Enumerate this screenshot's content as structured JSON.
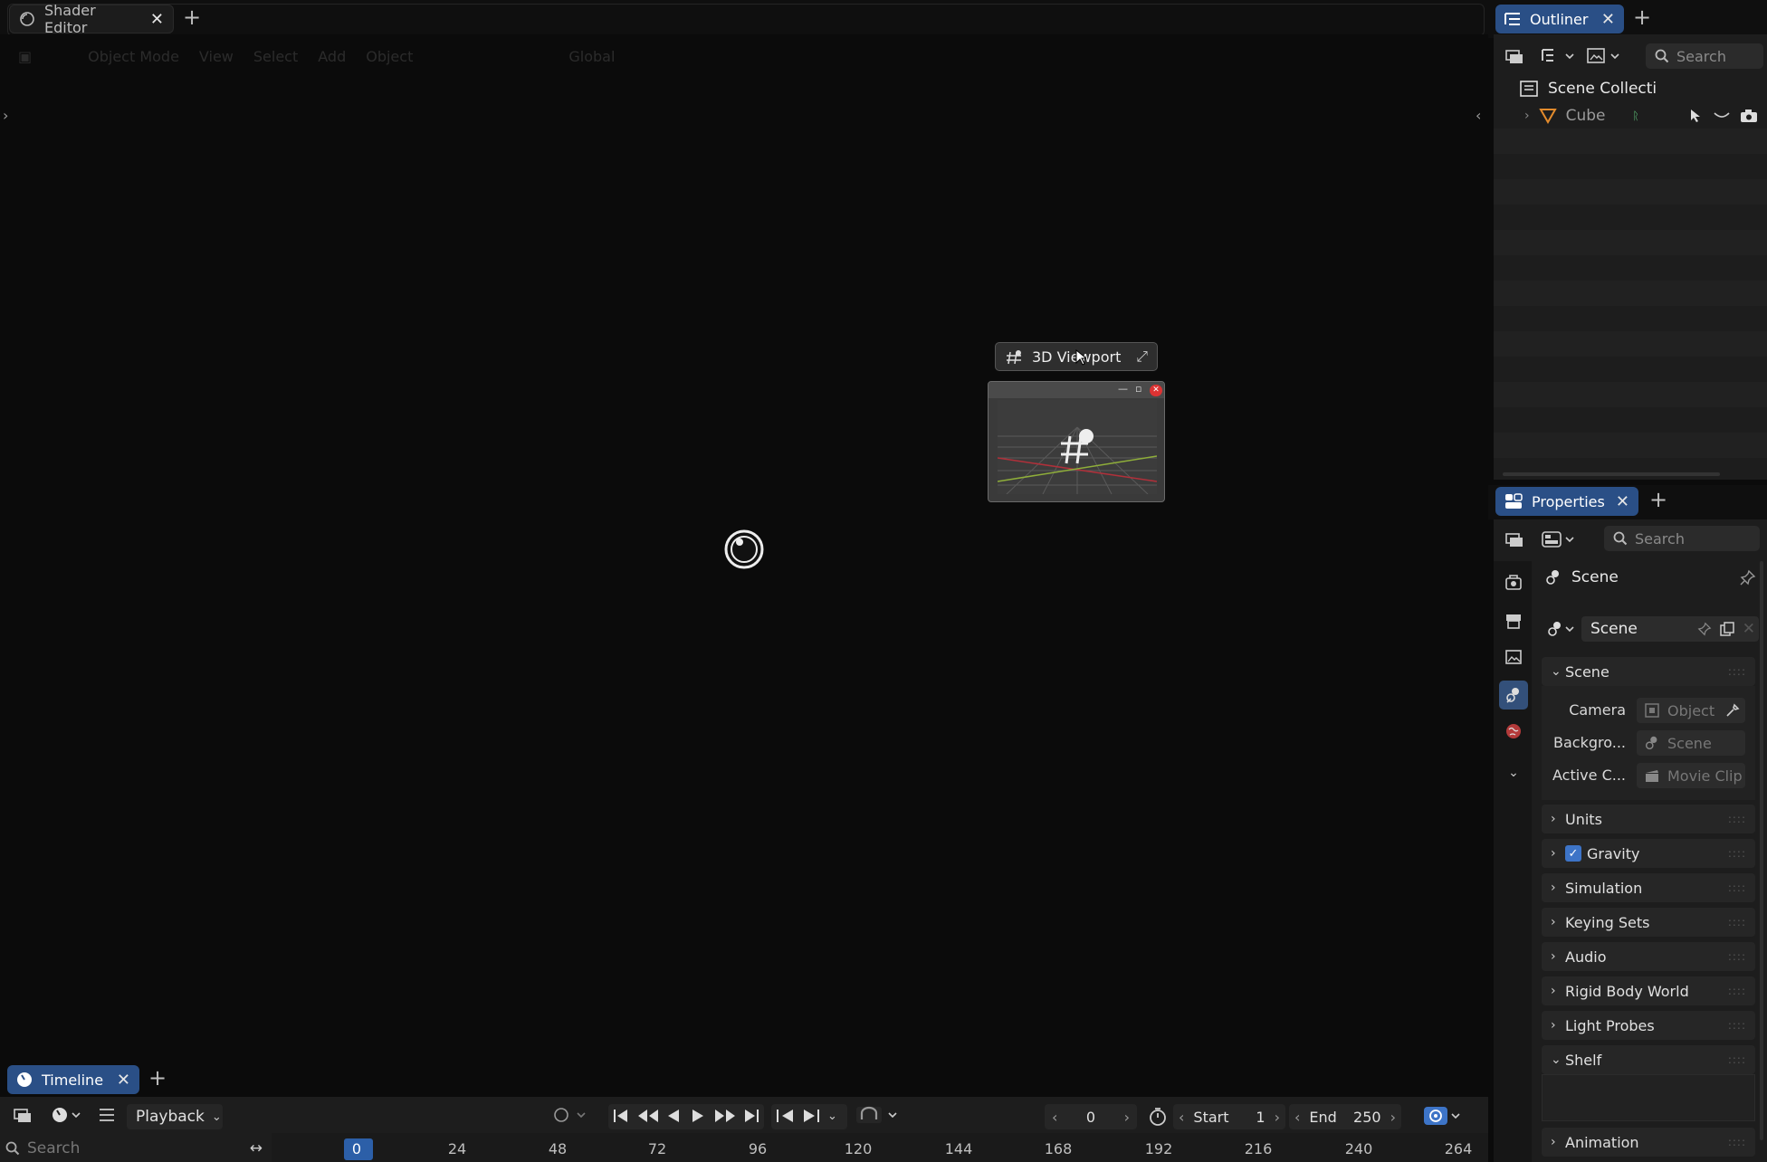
{
  "top_tabs": {
    "shader_editor": "Shader Editor",
    "outliner": "Outliner",
    "properties": "Properties",
    "timeline": "Timeline"
  },
  "editor_header": {
    "mode": "Object Mode",
    "view": "View",
    "select": "Select",
    "add": "Add",
    "object": "Object",
    "transform": "Global"
  },
  "floating": {
    "title": "3D Viewport"
  },
  "outliner": {
    "search_placeholder": "Search",
    "collection": "Scene Collecti",
    "object": "Cube"
  },
  "properties": {
    "search_placeholder": "Search",
    "context": "Scene",
    "datablock": "Scene",
    "panels": {
      "scene": "Scene",
      "units": "Units",
      "gravity": "Gravity",
      "simulation": "Simulation",
      "keying_sets": "Keying Sets",
      "audio": "Audio",
      "rigid_body_world": "Rigid Body World",
      "light_probes": "Light Probes",
      "shelf": "Shelf",
      "animation": "Animation"
    },
    "fields": {
      "camera_label": "Camera",
      "camera_value": "Object",
      "background_label": "Backgro...",
      "background_value": "Scene",
      "active_clip_label": "Active C...",
      "active_clip_value": "Movie Clip"
    },
    "gravity_checked": true
  },
  "timeline": {
    "playback": "Playback",
    "current_frame": "0",
    "start_label": "Start",
    "start_value": "1",
    "end_label": "End",
    "end_value": "250",
    "search_placeholder": "Search",
    "ruler": [
      "0",
      "24",
      "48",
      "72",
      "96",
      "120",
      "144",
      "168",
      "192",
      "216",
      "240",
      "264"
    ]
  },
  "colors": {
    "accent": "#2a4f86",
    "active_frame": "#2c5fa8"
  }
}
